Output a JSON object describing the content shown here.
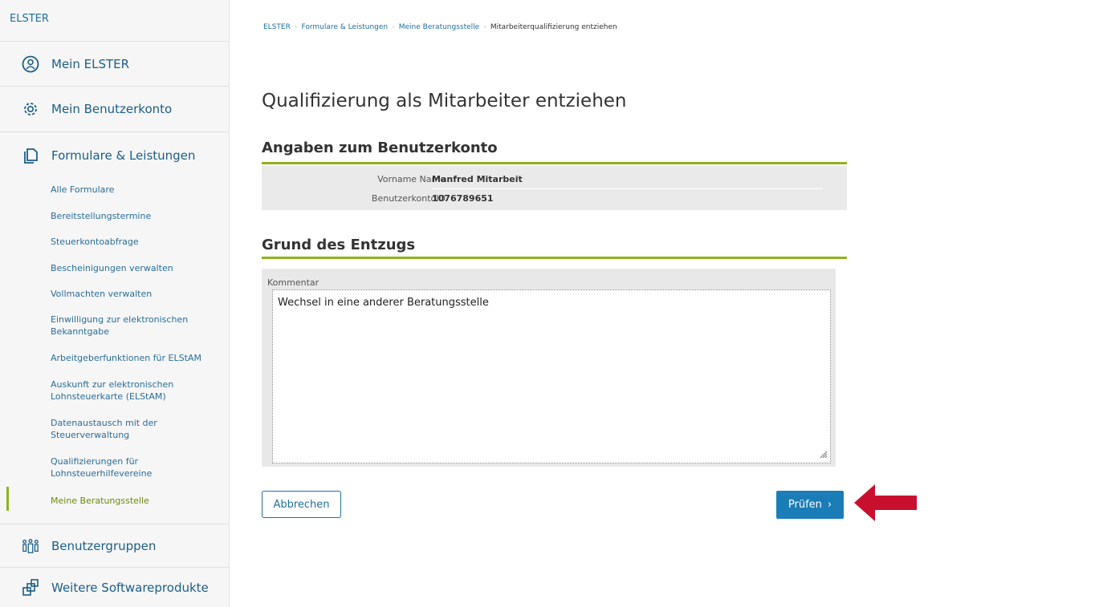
{
  "sidebar": {
    "brand": "ELSTER",
    "main_items": [
      {
        "label": "Mein ELSTER",
        "icon": "user-circle-icon"
      },
      {
        "label": "Mein Benutzerkonto",
        "icon": "gear-icon"
      },
      {
        "label": "Formulare & Leistungen",
        "icon": "documents-icon"
      },
      {
        "label": "Benutzergruppen",
        "icon": "users-group-icon"
      },
      {
        "label": "Weitere Softwareprodukte",
        "icon": "software-products-icon"
      }
    ],
    "sub_items": [
      "Alle Formulare",
      "Bereitstellungstermine",
      "Steuerkontoabfrage",
      "Bescheinigungen verwalten",
      "Vollmachten verwalten",
      "Einwilligung zur elektronischen Bekanntgabe",
      "Arbeitgeberfunktionen für ELStAM",
      "Auskunft zur elektronischen Lohnsteuerkarte (ELStAM)",
      "Datenaustausch mit der Steuerverwaltung",
      "Qualifizierungen für Lohnsteuerhilfevereine",
      "Meine Beratungsstelle"
    ]
  },
  "breadcrumb": [
    "ELSTER",
    "Formulare & Leistungen",
    "Meine Beratungsstelle",
    "Mitarbeiterqualifizierung entziehen"
  ],
  "page_title": "Qualifizierung als Mitarbeiter entziehen",
  "account_section": {
    "title": "Angaben zum Benutzerkonto",
    "rows": [
      {
        "key": "Vorname Name",
        "value": "Manfred Mitarbeit"
      },
      {
        "key": "BenutzerkontoID",
        "value": "1076789651"
      }
    ]
  },
  "reason_section": {
    "title": "Grund des Entzugs",
    "comment_label": "Kommentar",
    "comment_value": "Wechsel in eine anderer Beratungsstelle"
  },
  "buttons": {
    "cancel": "Abbrechen",
    "check": "Prüfen"
  },
  "colors": {
    "link_blue": "#1f6f9f",
    "primary_button": "#1b7db7",
    "accent_green": "#8fb31d",
    "annotation_arrow": "#c8102e"
  }
}
